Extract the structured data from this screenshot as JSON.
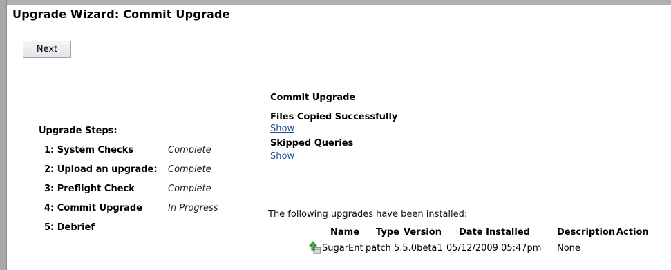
{
  "page": {
    "title": "Upgrade Wizard: Commit Upgrade"
  },
  "toolbar": {
    "next_label": "Next"
  },
  "steps": {
    "heading": "Upgrade Steps:",
    "items": [
      {
        "name": "1: System Checks",
        "status": "Complete"
      },
      {
        "name": "2: Upload an upgrade:",
        "status": "Complete"
      },
      {
        "name": "3: Preflight Check",
        "status": "Complete"
      },
      {
        "name": "4: Commit Upgrade",
        "status": "In Progress"
      },
      {
        "name": "5: Debrief",
        "status": ""
      }
    ]
  },
  "commit": {
    "heading": "Commit Upgrade",
    "files_label": "Files Copied Successfully",
    "files_show": "Show",
    "skipped_label": "Skipped Queries",
    "skipped_show": "Show"
  },
  "installed": {
    "intro": "The following upgrades have been installed:",
    "columns": [
      "Name",
      "Type",
      "Version",
      "Date Installed",
      "Description",
      "Action"
    ],
    "rows": [
      {
        "icon": "upgrade-package-icon",
        "name": "SugarEnt",
        "type": "patch",
        "version": "5.5.0beta1",
        "date": "05/12/2009 05:47pm",
        "description": "None",
        "action": ""
      }
    ]
  },
  "colors": {
    "link": "#1f4e9e",
    "frame": "#a8a8a8",
    "icon_arrow": "#3fae3a"
  }
}
